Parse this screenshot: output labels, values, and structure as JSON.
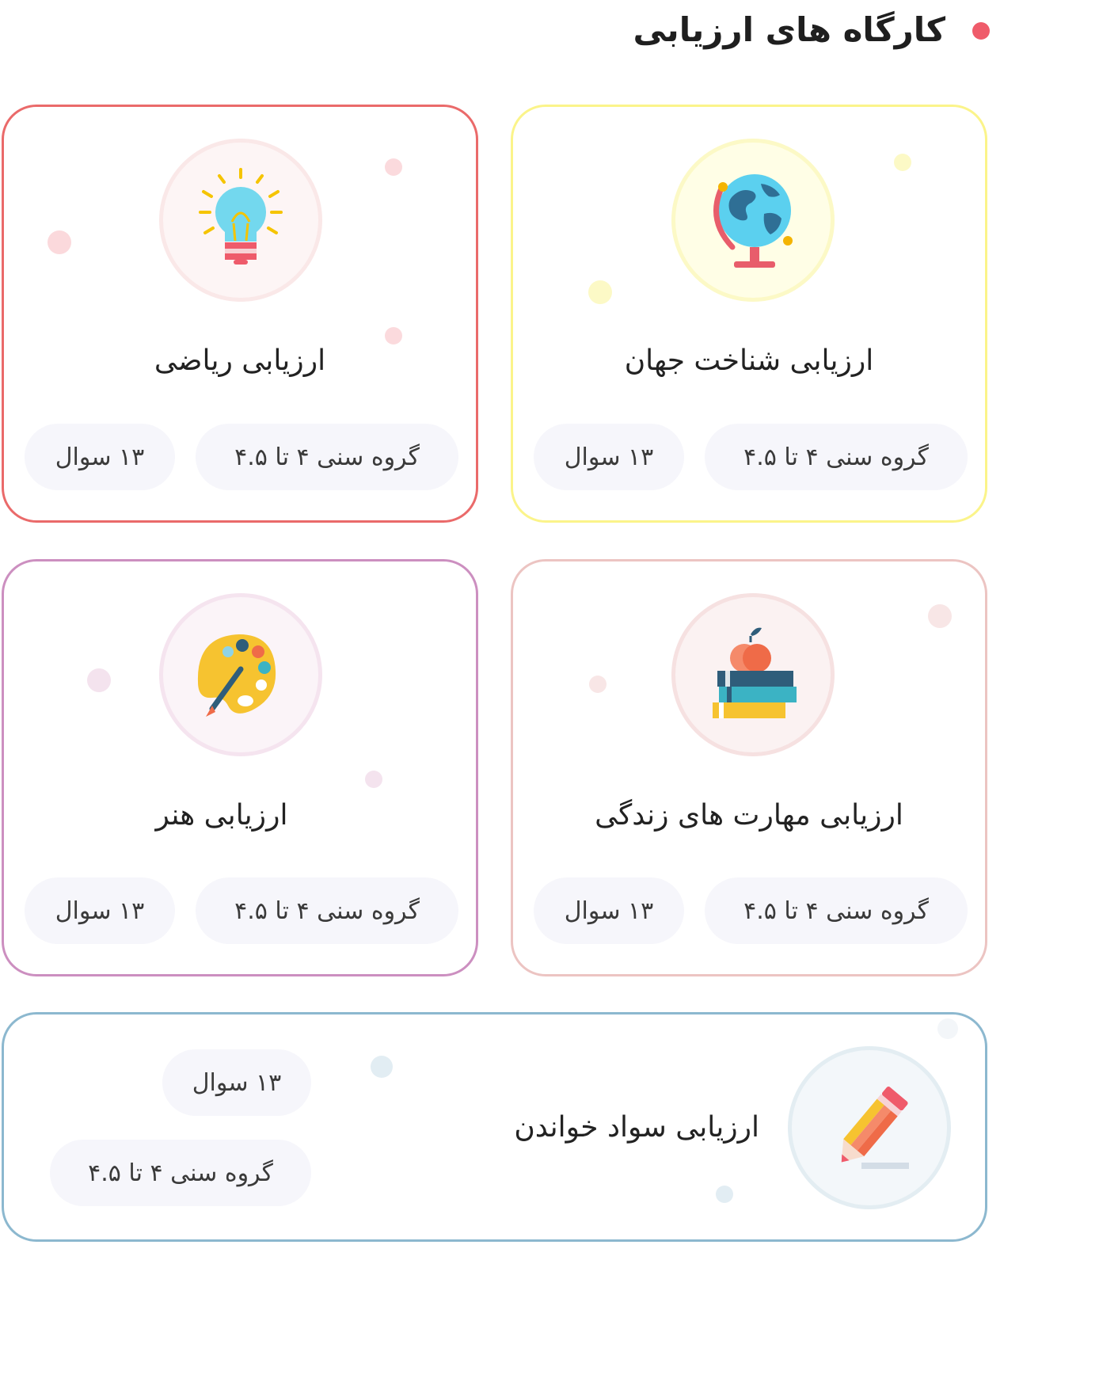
{
  "section": {
    "title": "کارگاه های ارزیابی"
  },
  "cards": [
    {
      "title": "ارزیابی شناخت جهان",
      "age": "گروه سنی ۴ تا ۴.۵",
      "questions": "۱۳ سوال",
      "icon": "globe-icon",
      "accent": "#fbf48a"
    },
    {
      "title": "ارزیابی ریاضی",
      "age": "گروه سنی ۴ تا ۴.۵",
      "questions": "۱۳ سوال",
      "icon": "lightbulb-icon",
      "accent": "#ea6a6a"
    },
    {
      "title": "ارزیابی مهارت های زندگی",
      "age": "گروه سنی ۴ تا ۴.۵",
      "questions": "۱۳ سوال",
      "icon": "books-apple-icon",
      "accent": "#ecc4c2"
    },
    {
      "title": "ارزیابی هنر",
      "age": "گروه سنی ۴ تا ۴.۵",
      "questions": "۱۳ سوال",
      "icon": "paint-palette-icon",
      "accent": "#cc8fc0"
    },
    {
      "title": "ارزیابی سواد خواندن",
      "age": "گروه سنی ۴ تا ۴.۵",
      "questions": "۱۳ سوال",
      "icon": "pencil-icon",
      "accent": "#8cb8cf"
    }
  ]
}
